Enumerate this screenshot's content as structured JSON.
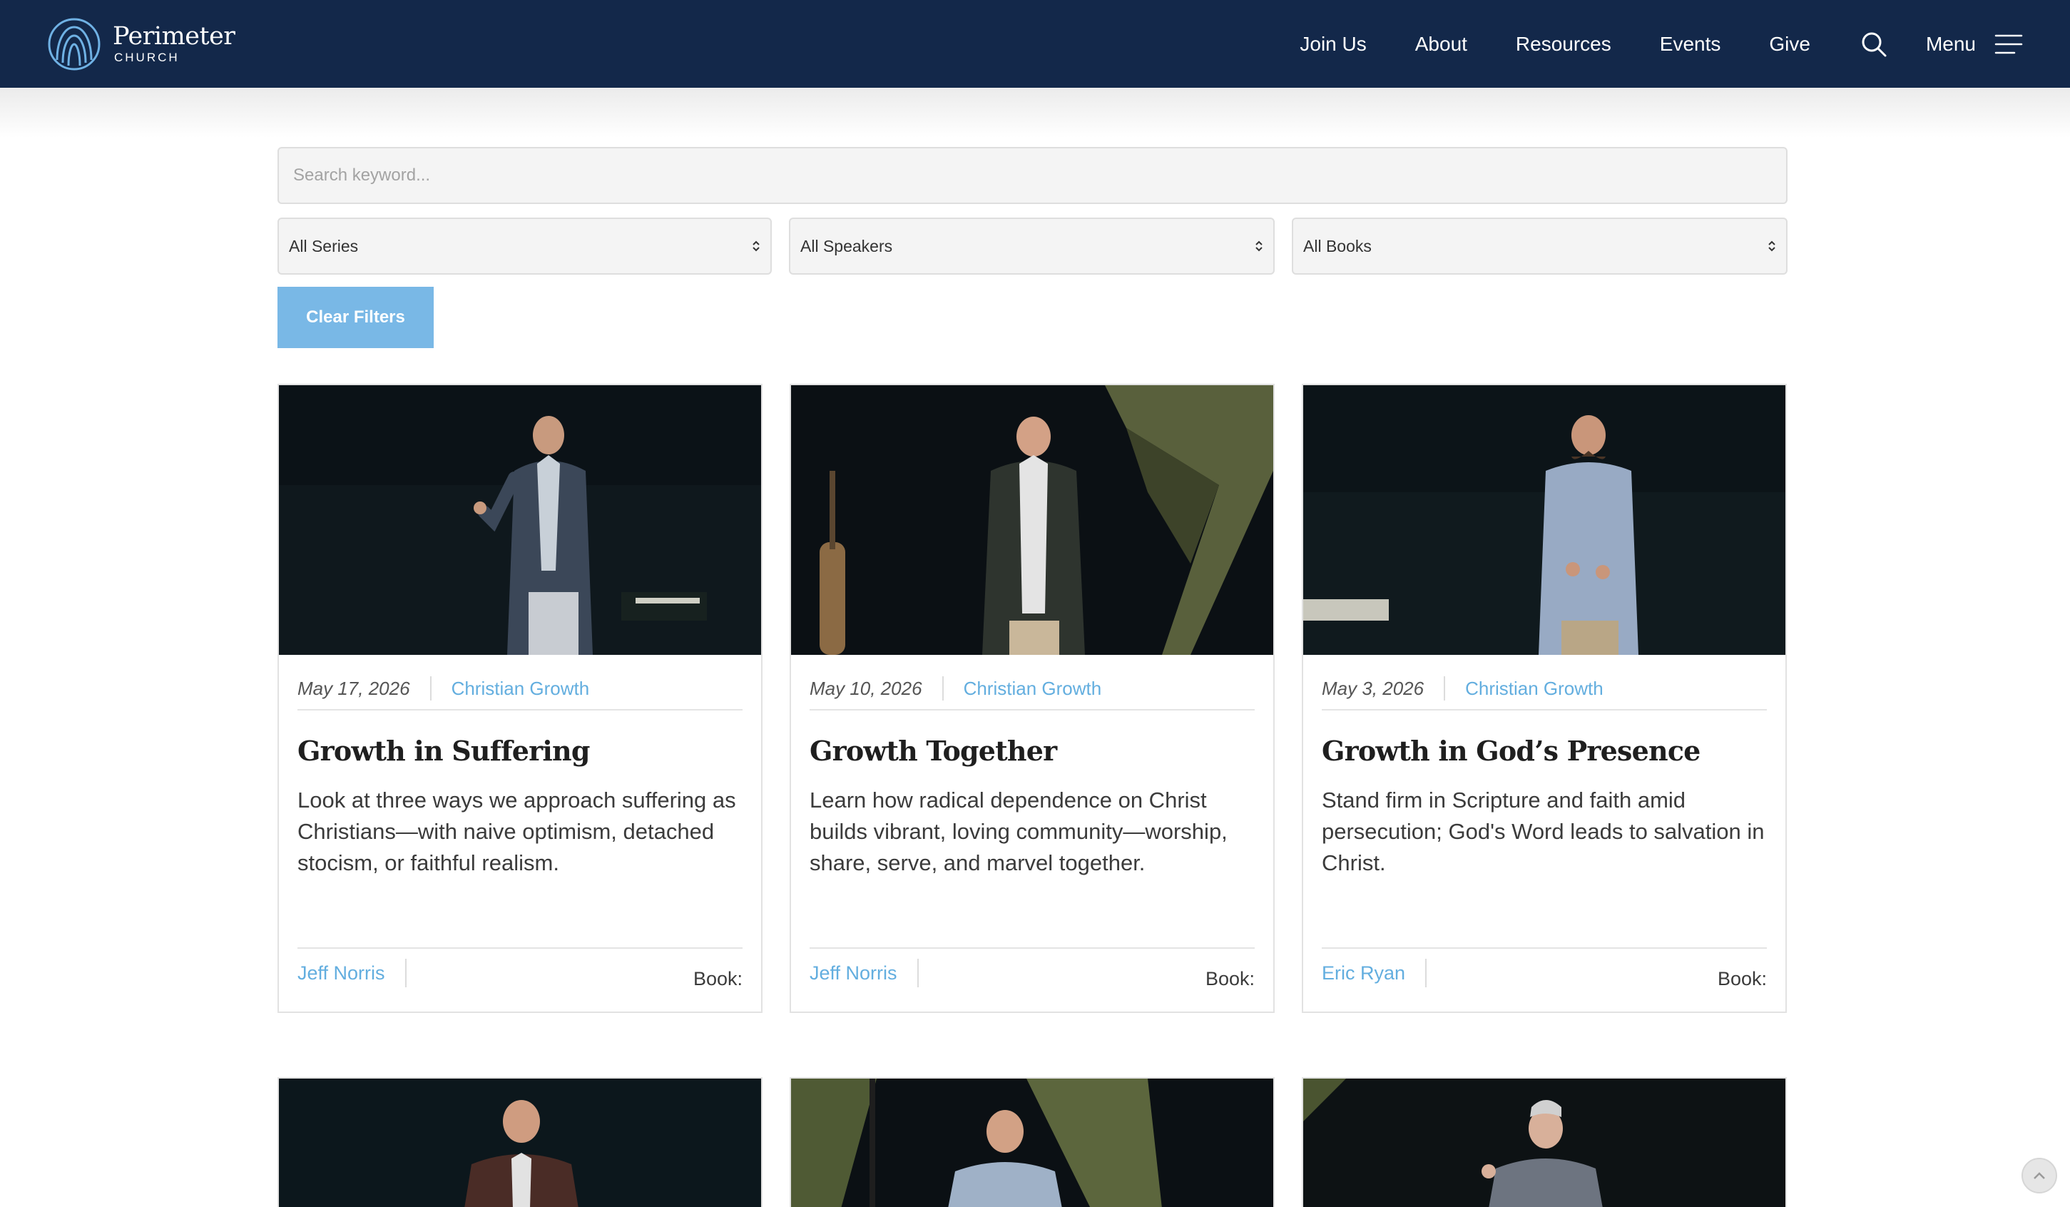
{
  "brand": {
    "name": "Perimeter",
    "sub": "CHURCH"
  },
  "nav": {
    "items": [
      "Join Us",
      "About",
      "Resources",
      "Events",
      "Give"
    ],
    "menu_label": "Menu"
  },
  "filters": {
    "search_placeholder": "Search keyword...",
    "series": "All Series",
    "speakers": "All Speakers",
    "books": "All Books",
    "clear_label": "Clear Filters"
  },
  "sermons": [
    {
      "date": "May 17, 2026",
      "series": "Christian Growth",
      "title": "Growth in Suffering",
      "description": "Look at three ways we approach suffering as Christians—with naive optimism, detached stocism, or faithful realism.",
      "speaker": "Jeff Norris",
      "book": "Book:"
    },
    {
      "date": "May 10, 2026",
      "series": "Christian Growth",
      "title": "Growth Together",
      "description": "Learn how radical dependence on Christ builds vibrant, loving community—worship, share, serve, and marvel together.",
      "speaker": "Jeff Norris",
      "book": "Book:"
    },
    {
      "date": "May 3, 2026",
      "series": "Christian Growth",
      "title": "Growth in God’s Presence",
      "description": "Stand firm in Scripture and faith amid persecution; God's Word leads to salvation in Christ.",
      "speaker": "Eric Ryan",
      "book": "Book:"
    }
  ],
  "colors": {
    "header_bg": "#13284a",
    "accent": "#63aedf",
    "button_bg": "#79b8e6",
    "card_border": "#e2e2e2"
  },
  "icons": {
    "logo": "arches-logo-icon",
    "search": "search-icon",
    "menu": "hamburger-icon",
    "select": "chevron-updown-icon",
    "scroll_top": "chevron-up-icon"
  }
}
